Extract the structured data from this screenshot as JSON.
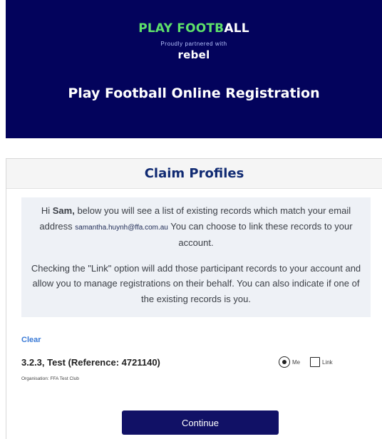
{
  "banner": {
    "brand_part1": "PLAY FOOTB",
    "brand_part2": "ALL",
    "partner_text": "Proudly partnered with",
    "partner_name": "rebel",
    "title": "Play Football Online Registration",
    "background_color": "#03035c",
    "brand_accent_color": "#5ee06a"
  },
  "card": {
    "title": "Claim Profiles",
    "info": {
      "line1_prefix": "Hi ",
      "user_name": "Sam,",
      "line1_suffix": " below you will see a list of existing records which match your email address ",
      "email": "samantha.huynh@ffa.com.au",
      "line1_end": " You can choose to link these records to your account.",
      "paragraph2": "Checking the \"Link\" option will add those participant records to your account and allow you to manage registrations on their behalf. You can also indicate if one of the existing records is you."
    },
    "clear_label": "Clear",
    "record": {
      "name": "3.2.3, Test (Reference: 4721140)",
      "organisation": "Organisation: FFA Test Club",
      "me_label": "Me",
      "link_label": "Link",
      "me_selected": true,
      "link_checked": false
    },
    "continue_label": "Continue",
    "button_color": "#111166"
  }
}
